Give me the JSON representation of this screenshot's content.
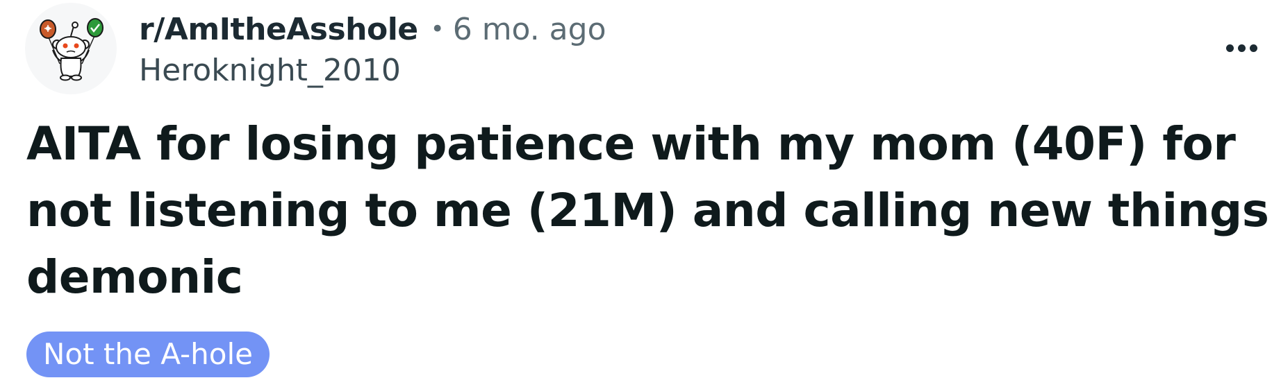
{
  "post": {
    "subreddit": "r/AmItheAsshole",
    "separator": "•",
    "time_ago": "6 mo. ago",
    "username": "Heroknight_2010",
    "title": "AITA for losing patience with my mom (40F) for not listening to me (21M) and calling new things demonic",
    "flair": "Not the A-hole",
    "more_icon": "more-options-icon",
    "avatar_icon": "snoo-avatar-icon"
  },
  "colors": {
    "flair_background": "#7393f5",
    "flair_text": "#ffffff",
    "title_text": "#0f1a1c",
    "meta_text": "#5c6c74"
  }
}
